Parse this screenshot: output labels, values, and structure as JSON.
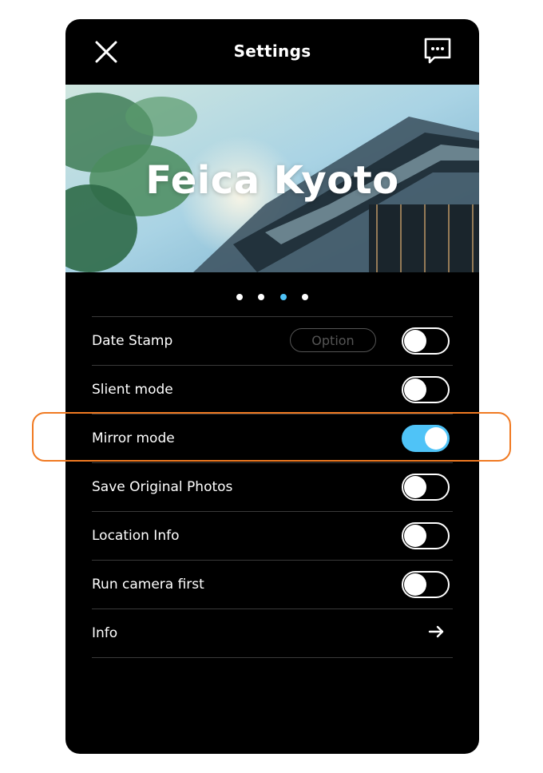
{
  "header": {
    "title": "Settings",
    "close_icon": "close-icon",
    "chat_icon": "chat-bubble-icon"
  },
  "banner": {
    "title": "Feica Kyoto"
  },
  "pagination": {
    "count": 4,
    "active_index": 2,
    "active_color": "#4fc3f7"
  },
  "settings": {
    "rows": [
      {
        "label": "Date Stamp",
        "option_label": "Option",
        "toggle": false
      },
      {
        "label": "Slient mode",
        "toggle": false
      },
      {
        "label": "Mirror mode",
        "toggle": true
      },
      {
        "label": "Save Original Photos",
        "toggle": false
      },
      {
        "label": "Location Info",
        "toggle": false
      },
      {
        "label": "Run camera first",
        "toggle": false
      },
      {
        "label": "Info",
        "arrow_icon": "arrow-right-icon"
      }
    ]
  },
  "colors": {
    "background": "#000000",
    "accent": "#4fc3f7",
    "highlight": "#f07a22"
  }
}
